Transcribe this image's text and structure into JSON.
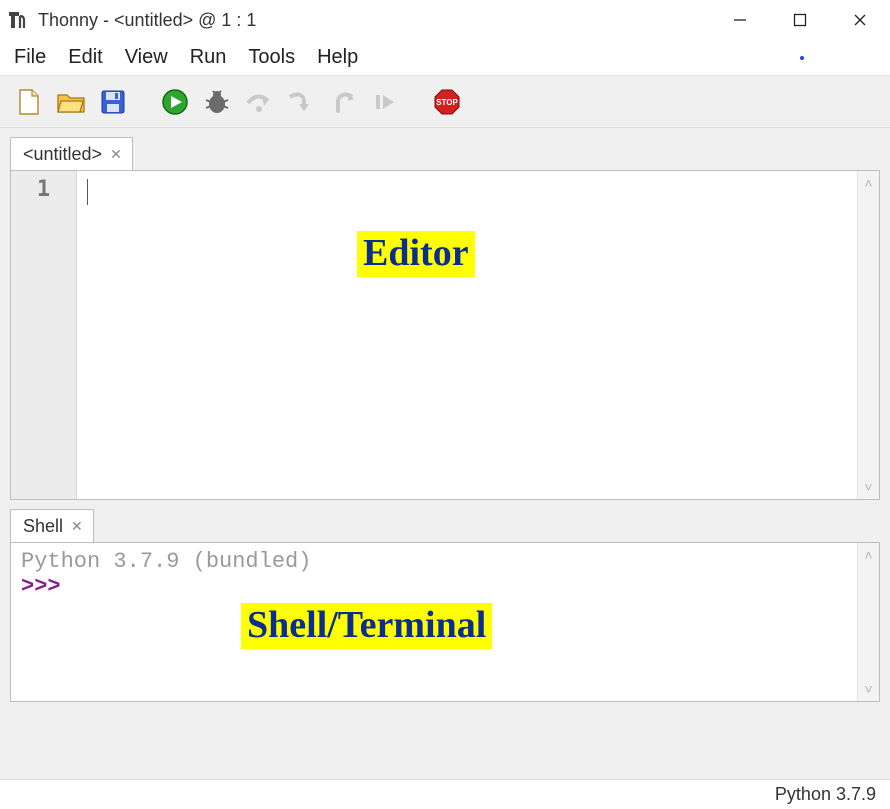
{
  "titlebar": {
    "app_name": "Thonny",
    "title": "Thonny  -  <untitled>  @  1 : 1"
  },
  "menubar": {
    "items": [
      "File",
      "Edit",
      "View",
      "Run",
      "Tools",
      "Help"
    ]
  },
  "toolbar": {
    "icons": [
      "new-file-icon",
      "open-file-icon",
      "save-icon",
      "run-icon",
      "debug-icon",
      "step-over-icon",
      "step-into-icon",
      "step-out-icon",
      "resume-icon",
      "stop-icon"
    ]
  },
  "editor": {
    "tab_label": "<untitled>",
    "line_number": "1",
    "annotation_label": "Editor"
  },
  "shell": {
    "tab_label": "Shell",
    "banner": "Python 3.7.9 (bundled)",
    "prompt": ">>>",
    "annotation_label": "Shell/Terminal"
  },
  "statusbar": {
    "interpreter": "Python 3.7.9"
  }
}
